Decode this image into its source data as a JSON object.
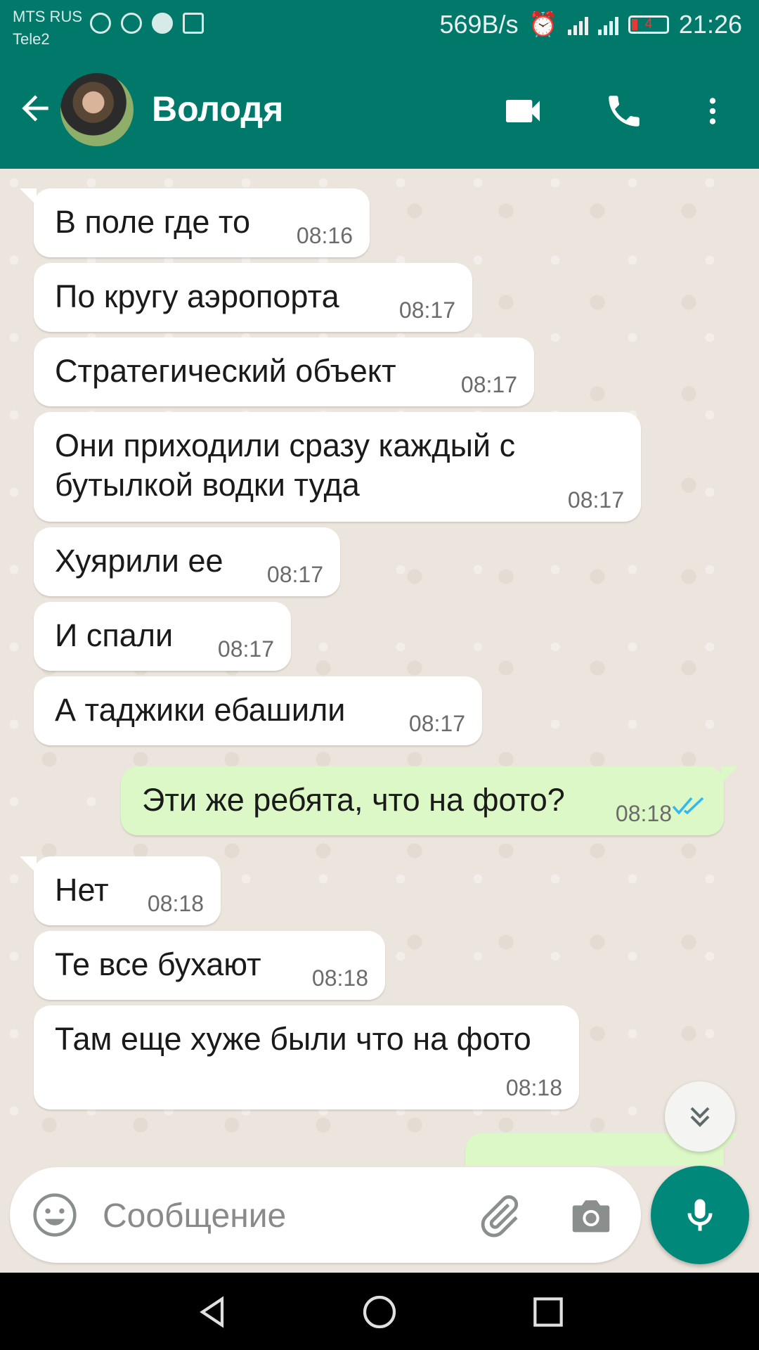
{
  "status_bar": {
    "carrier_1": "MTS RUS",
    "carrier_2": "Tele2",
    "speed": "569B/s",
    "battery_level": "4",
    "time": "21:26"
  },
  "header": {
    "contact_name": "Володя",
    "icons": [
      "back-arrow-icon",
      "video-call-icon",
      "phone-icon",
      "more-vert-icon"
    ]
  },
  "messages": [
    {
      "text": "В поле где то",
      "time": "08:16",
      "direction": "in"
    },
    {
      "text": "По кругу аэропорта",
      "time": "08:17",
      "direction": "in"
    },
    {
      "text": "Стратегический объект",
      "time": "08:17",
      "direction": "in"
    },
    {
      "text_line1": "Они приходили сразу каждый с",
      "text_line2": "бутылкой водки туда",
      "time": "08:17",
      "direction": "in"
    },
    {
      "text": "Хуярили ее",
      "time": "08:17",
      "direction": "in"
    },
    {
      "text": "И спали",
      "time": "08:17",
      "direction": "in"
    },
    {
      "text": "А таджики ебашили",
      "time": "08:17",
      "direction": "in"
    },
    {
      "text": "Эти же ребята, что на фото?",
      "time": "08:18",
      "direction": "out",
      "status": "read"
    },
    {
      "text": "Нет",
      "time": "08:18",
      "direction": "in"
    },
    {
      "text": "Те все бухают",
      "time": "08:18",
      "direction": "in"
    },
    {
      "text": "Там еще хуже были что на фото",
      "time": "08:18",
      "direction": "in"
    }
  ],
  "composer": {
    "placeholder": "Сообщение"
  },
  "colors": {
    "header": "#00796b",
    "incoming_bubble": "#ffffff",
    "outgoing_bubble": "#dcf8c6",
    "read_ticks": "#34b7f1",
    "mic_button": "#00897b"
  }
}
